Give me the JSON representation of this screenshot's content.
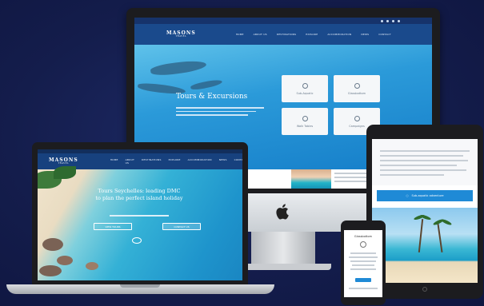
{
  "brand": {
    "logo_text": "MASONS",
    "logo_sub": "TRAVEL"
  },
  "desktop": {
    "nav_items": [
      "HOME",
      "ABOUT US",
      "DESTINATIONS",
      "EXPLORE",
      "ACCOMMODATION",
      "NEWS",
      "CONTACT"
    ],
    "hero_title": "Tours & Excursions",
    "cards": [
      {
        "label": "Sub-Aquatic",
        "icon": "fish-icon"
      },
      {
        "label": "Glassbottom",
        "icon": "boat-icon"
      },
      {
        "label": "Walk Tables",
        "icon": "walk-icon"
      },
      {
        "label": "Campaigns",
        "icon": "flag-icon"
      }
    ]
  },
  "laptop": {
    "nav_items": [
      "HOME",
      "ABOUT US",
      "DESTINATIONS",
      "EXPLORE",
      "ACCOMMODATION",
      "NEWS",
      "CONTACT"
    ],
    "hero_heading_line1": "Tours Seychelles: leading DMC",
    "hero_heading_line2": "to plan the perfect island holiday",
    "button_left": "VIEW TOURS",
    "button_right": "CONTACT US"
  },
  "tablet": {
    "bar_label": "Sub-aquatic adventure"
  },
  "phone": {
    "title": "Glassbottom"
  },
  "colors": {
    "background": "#141d4c",
    "brand_blue": "#1a4a8c",
    "accent_blue": "#1f8ad6"
  }
}
